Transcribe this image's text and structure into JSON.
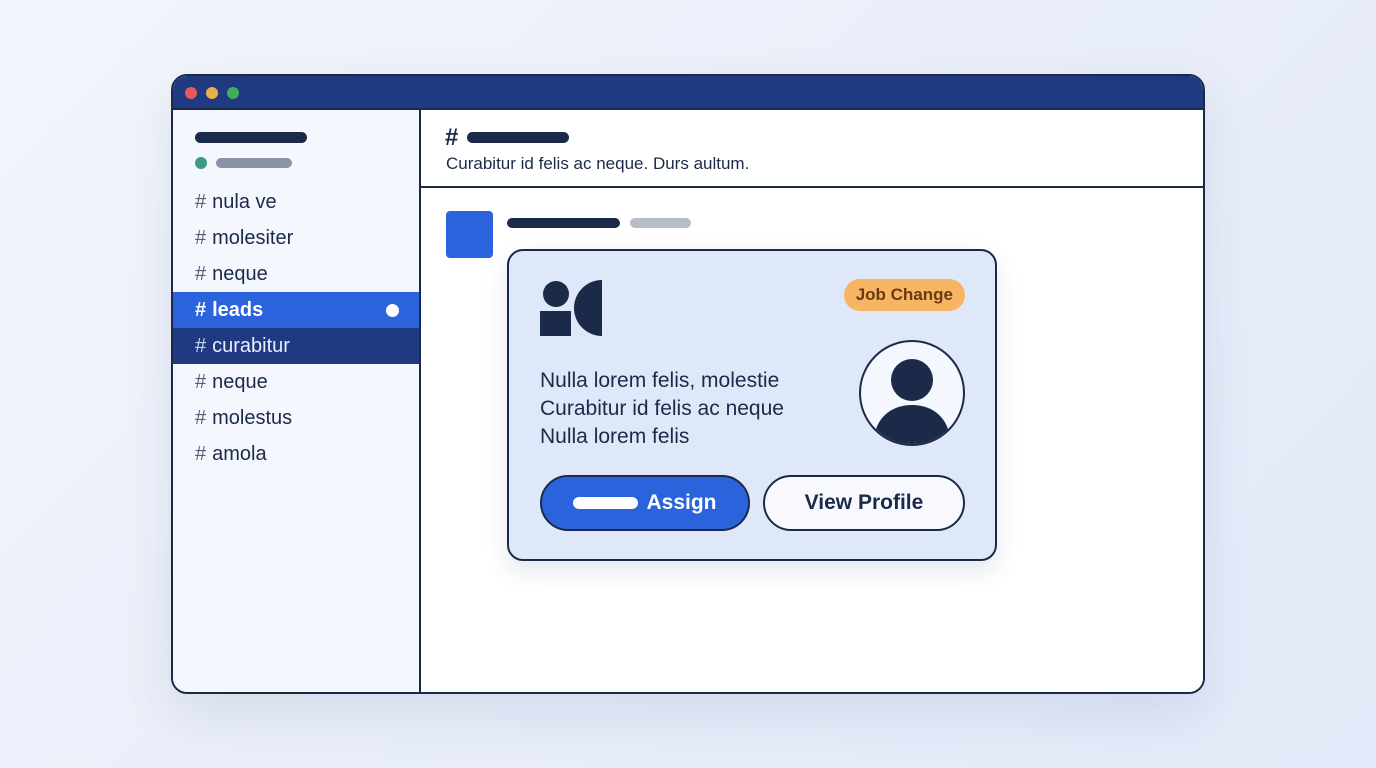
{
  "window": {
    "controls": [
      "close",
      "minimize",
      "maximize"
    ]
  },
  "sidebar": {
    "channels": [
      {
        "hash": "#",
        "label": "nula ve"
      },
      {
        "hash": "#",
        "label": "molesiter"
      },
      {
        "hash": "#",
        "label": "neque"
      },
      {
        "hash": "#",
        "label": "leads"
      },
      {
        "hash": "#",
        "label": "curabitur"
      },
      {
        "hash": "#",
        "label": "neque"
      },
      {
        "hash": "#",
        "label": "molestus"
      },
      {
        "hash": "#",
        "label": "amola"
      }
    ],
    "active_channel": "leads",
    "hovered_channel": "curabitur"
  },
  "channel": {
    "hash": "#",
    "topic": "Curabitur id felis ac neque. Durs aultum."
  },
  "card": {
    "badge": "Job Change",
    "lines": [
      "Nulla lorem felis, molestie",
      "Curabitur id felis ac neque",
      "Nulla lorem felis"
    ],
    "assign_label": "Assign",
    "view_profile_label": "View Profile",
    "logo_icon": "company-logo-icon",
    "avatar_icon": "user-avatar-icon"
  },
  "colors": {
    "titlebar": "#1f3a80",
    "accent": "#2a63dc",
    "badge": "#f7b563",
    "card_bg": "#dfe8f9",
    "ink": "#1c2a4a"
  }
}
